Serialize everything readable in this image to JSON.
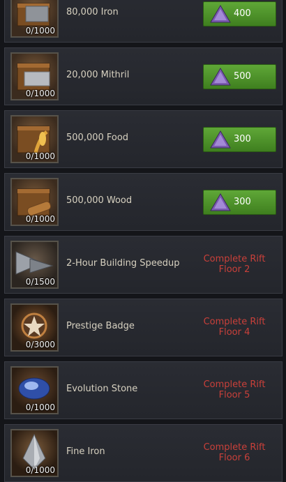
{
  "items": [
    {
      "name": "80,000 Iron",
      "count": "0/1000",
      "icon": "iron-chest-icon",
      "price": "400"
    },
    {
      "name": "20,000 Mithril",
      "count": "0/1000",
      "icon": "mithril-chest-icon",
      "price": "500"
    },
    {
      "name": "500,000 Food",
      "count": "0/1000",
      "icon": "food-chest-icon",
      "price": "300"
    },
    {
      "name": "500,000 Wood",
      "count": "0/1000",
      "icon": "wood-chest-icon",
      "price": "300"
    },
    {
      "name": "2-Hour Building Speedup",
      "count": "0/1500",
      "icon": "speedup-icon",
      "requirement": "Complete Rift Floor 2"
    },
    {
      "name": "Prestige Badge",
      "count": "0/3000",
      "icon": "prestige-badge-icon",
      "requirement": "Complete Rift Floor 4"
    },
    {
      "name": "Evolution Stone",
      "count": "0/1000",
      "icon": "evolution-stone-icon",
      "requirement": "Complete Rift Floor 5"
    },
    {
      "name": "Fine Iron",
      "count": "0/1000",
      "icon": "fine-iron-icon",
      "requirement": "Complete Rift Floor 6"
    }
  ],
  "colors": {
    "buy_green": "#4f9a2a",
    "requirement_red": "#c9403a",
    "row_bg": "#2a2c33"
  }
}
